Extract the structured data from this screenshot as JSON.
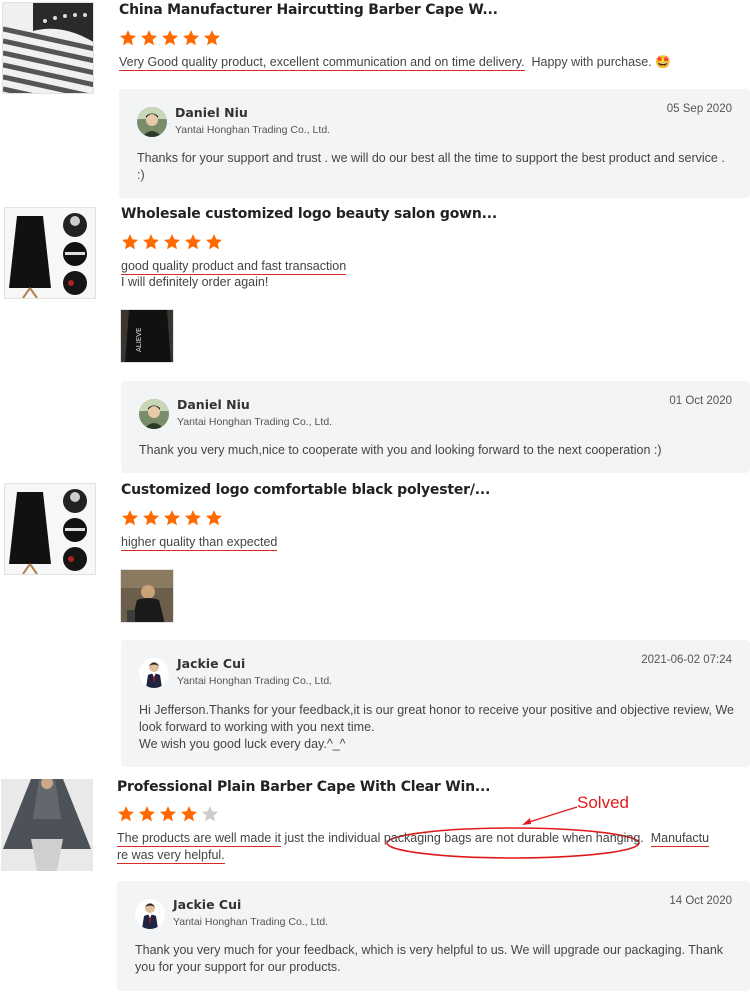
{
  "colors": {
    "star_filled": "#ff6a00",
    "star_empty": "#cccccc",
    "underline": "#d42a2a",
    "reply_bg": "#f3f4f6",
    "annotation": "#e01a1a"
  },
  "reviews": [
    {
      "title": "China Manufacturer Haircutting Barber Cape W...",
      "rating": 5,
      "text_underlined": "Very Good quality product, excellent communication and on time delivery.",
      "text_rest": "Happy with purchase.",
      "emoji": "🤩",
      "reply": {
        "name": "Daniel Niu",
        "company": "Yantai Honghan Trading Co., Ltd.",
        "date": "05 Sep 2020",
        "line1": "Thanks for your support and trust . we will do our best all the time to support the best product and service .",
        "line2": ":)"
      }
    },
    {
      "title": "Wholesale customized logo beauty salon gown...",
      "rating": 5,
      "text_underlined": "good quality product and fast transaction",
      "text_line2": "I will definitely order again!",
      "reply": {
        "name": "Daniel Niu",
        "company": "Yantai Honghan Trading Co., Ltd.",
        "date": "01 Oct 2020",
        "line1": "Thank you very much,nice to cooperate with you and looking forward to the next cooperation :)"
      }
    },
    {
      "title": "Customized logo comfortable black polyester/...",
      "rating": 5,
      "text_underlined": "higher quality than expected",
      "reply": {
        "name": "Jackie Cui",
        "company": "Yantai Honghan Trading Co., Ltd.",
        "date": "2021-06-02 07:24",
        "line1": "Hi Jefferson.Thanks for your feedback,it is our great honor to receive your positive and objective review, We",
        "line2": "look forward to working with you next time.",
        "line3": "We wish you good luck every day.^_^"
      }
    },
    {
      "title": "Professional Plain Barber Cape With Clear Win...",
      "rating": 4,
      "text_part1": "The products are well made it",
      "text_part2": "just the individual",
      "text_part3": "packaging bags are not durable when hanging.",
      "text_part4": "Manufactu",
      "text_line2": "re was very helpful.",
      "annotation": "Solved",
      "reply": {
        "name": "Jackie Cui",
        "company": "Yantai Honghan Trading Co., Ltd.",
        "date": "14 Oct 2020",
        "line1": "Thank you very much for your feedback, which is very helpful to us. We will upgrade our packaging. Thank",
        "line2": "you for your support for our products."
      }
    }
  ]
}
